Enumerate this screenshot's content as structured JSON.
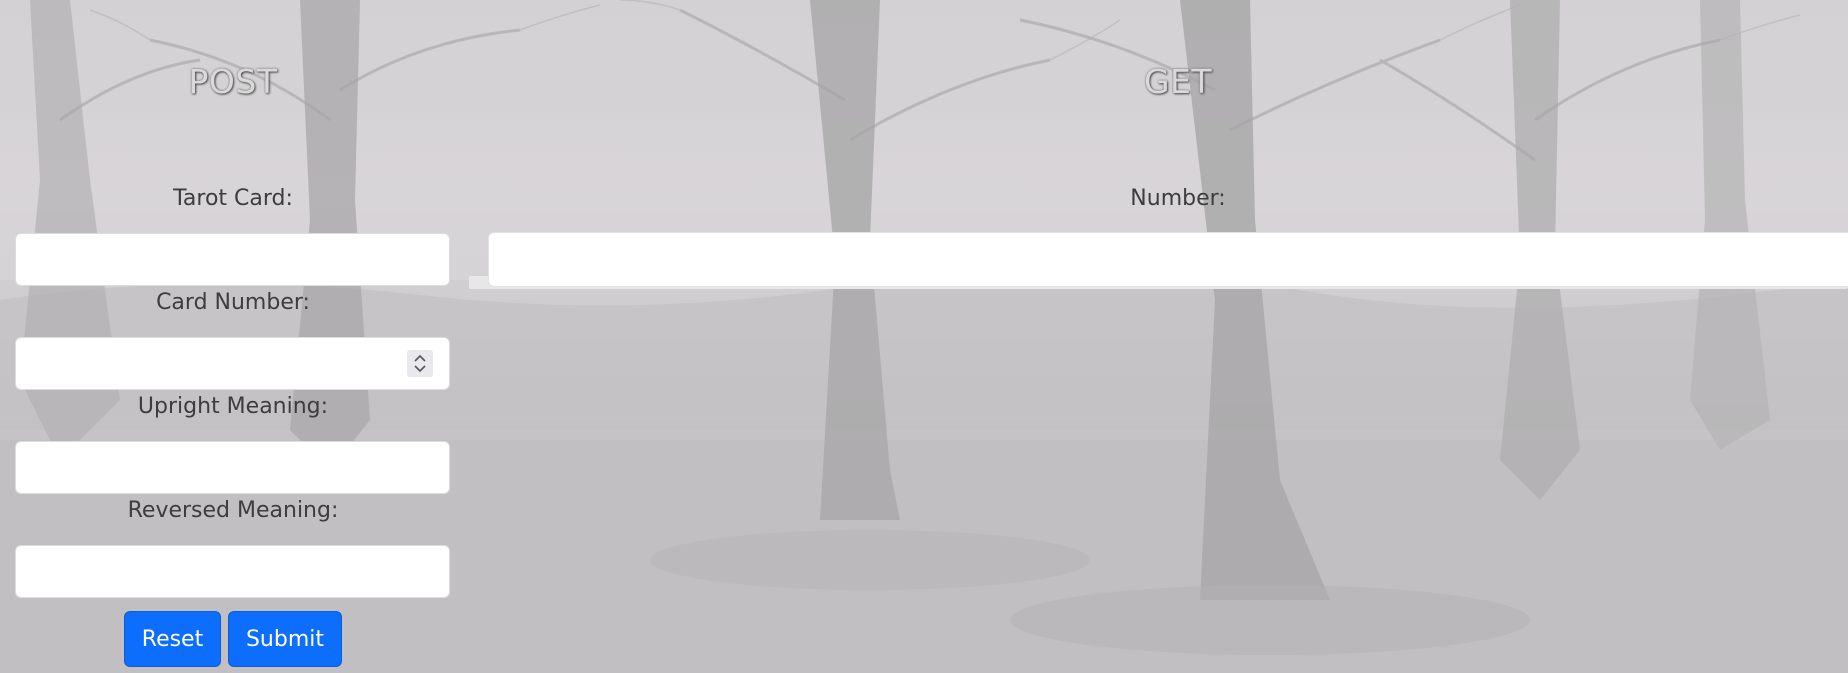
{
  "post": {
    "title": "POST",
    "tarot_card_label": "Tarot Card:",
    "tarot_card_value": "",
    "card_number_label": "Card Number:",
    "card_number_value": "",
    "upright_meaning_label": "Upright Meaning:",
    "upright_meaning_value": "",
    "reversed_meaning_label": "Reversed Meaning:",
    "reversed_meaning_value": "",
    "reset_label": "Reset",
    "submit_label": "Submit"
  },
  "get": {
    "title": "GET",
    "number_label": "Number:",
    "number_value": ""
  },
  "colors": {
    "button": "#0d6efd",
    "heading": "#d9d9d9",
    "label_text": "#3d3d3d"
  },
  "icons": {
    "spinner": "spin-up-down-icon"
  }
}
